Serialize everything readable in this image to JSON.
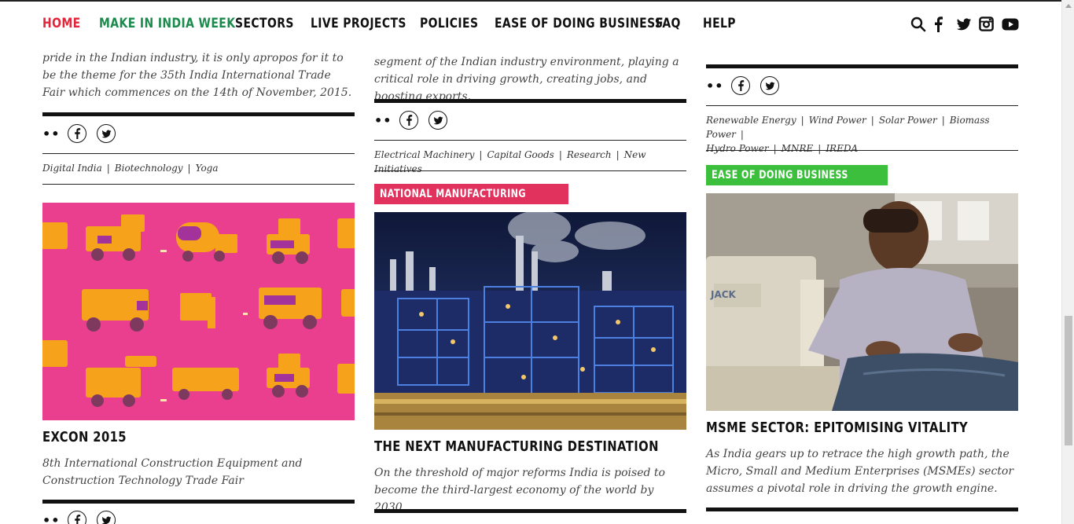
{
  "nav": {
    "items": [
      "HOME",
      "MAKE IN INDIA WEEK",
      "SECTORS",
      "LIVE PROJECTS",
      "POLICIES",
      "EASE OF DOING BUSINESS",
      "FAQ",
      "HELP"
    ],
    "active_color": "#e1253a",
    "highlight_color": "#1b8a4c",
    "icons": [
      "search-icon",
      "facebook-icon",
      "twitter-icon",
      "instagram-icon",
      "youtube-icon"
    ]
  },
  "col1": {
    "excerpt": "pride in the Indian industry, it is only apropos for it to be the theme for the 35th India International Trade Fair which commences on the 14th of November, 2015.",
    "tags": [
      "Digital India",
      "Biotechnology",
      "Yoga"
    ],
    "card": {
      "title": "EXCON 2015",
      "excerpt": "8th International Construction Equipment and Construction Technology Trade Fair"
    }
  },
  "col2": {
    "excerpt": "segment of the Indian industry environment, playing a critical role in driving growth, creating jobs, and boosting exports.",
    "tags": [
      "Electrical Machinery",
      "Capital Goods",
      "Research",
      "New Initiatives"
    ],
    "card": {
      "badge": "NATIONAL MANUFACTURING",
      "badge_color": "#e1325e",
      "title": "THE NEXT MANUFACTURING DESTINATION",
      "excerpt": "On the threshold of major reforms India is poised to become the third-largest economy of the world by 2030."
    }
  },
  "col3": {
    "tags": [
      "Renewable Energy",
      "Wind Power",
      "Solar Power",
      "Biomass Power",
      "Hydro Power",
      "MNRE",
      "IREDA"
    ],
    "card": {
      "badge": "EASE OF DOING BUSINESS",
      "badge_color": "#3cbf3c",
      "title": "MSME SECTOR: EPITOMISING VITALITY",
      "excerpt": "As India gears up to retrace the high growth path, the Micro, Small and Medium Enterprises (MSMEs) sector assumes a pivotal role in driving the growth engine."
    }
  },
  "share": {
    "dots": "••"
  },
  "colors": {
    "excon_bg": "#ea3f8f"
  }
}
